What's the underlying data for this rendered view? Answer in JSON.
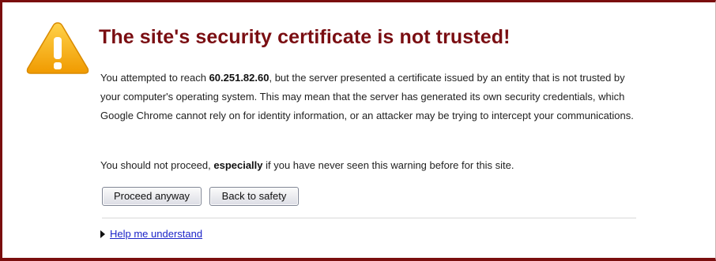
{
  "warning": {
    "icon": "warning-triangle-icon",
    "icon_color": "#f5a800",
    "title": "The site's security certificate is not trusted!",
    "title_color": "#7a0e12"
  },
  "paragraph1": {
    "before_host": "You attempted to reach ",
    "host": "60.251.82.60",
    "after_host": ", but the server presented a certificate issued by an entity that is not trusted by your computer's operating system. This may mean that the server has generated its own security credentials, which Google Chrome cannot rely on for identity information, or an attacker may be trying to intercept your communications."
  },
  "paragraph2": {
    "before_bold": "You should not proceed, ",
    "bold": "especially",
    "after_bold": " if you have never seen this warning before for this site."
  },
  "buttons": {
    "proceed_label": "Proceed anyway",
    "back_label": "Back to safety"
  },
  "help": {
    "expander_icon": "triangle-right-icon",
    "link_label": "Help me understand",
    "link_color": "#1c24c8"
  },
  "frame_color": "#7a0e0e"
}
